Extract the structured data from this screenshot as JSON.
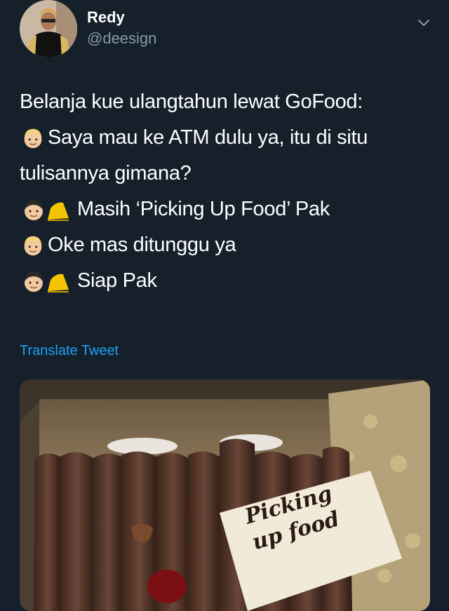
{
  "author": {
    "name": "Redy",
    "handle": "@deesign"
  },
  "tweet": {
    "lines": [
      {
        "emoji": "none",
        "text": "Belanja kue ulangtahun lewat GoFood:"
      },
      {
        "emoji": "blond-man",
        "text": "Saya mau ke ATM dulu ya, itu di situ"
      },
      {
        "emoji": "none",
        "text": "tulisannya gimana?"
      },
      {
        "emoji": "driver-man-with-helmet",
        "text": "Masih ‘Picking Up Food’ Pak"
      },
      {
        "emoji": "blond-man",
        "text": "Oke mas ditunggu ya"
      },
      {
        "emoji": "driver-man-with-helmet",
        "text": "Siap Pak"
      }
    ]
  },
  "translate_label": "Translate Tweet",
  "photo": {
    "card_line1": "Picking",
    "card_line2": "up food"
  },
  "colors": {
    "background": "#15202b",
    "link": "#1da1f2",
    "secondary_text": "#8899a6"
  }
}
